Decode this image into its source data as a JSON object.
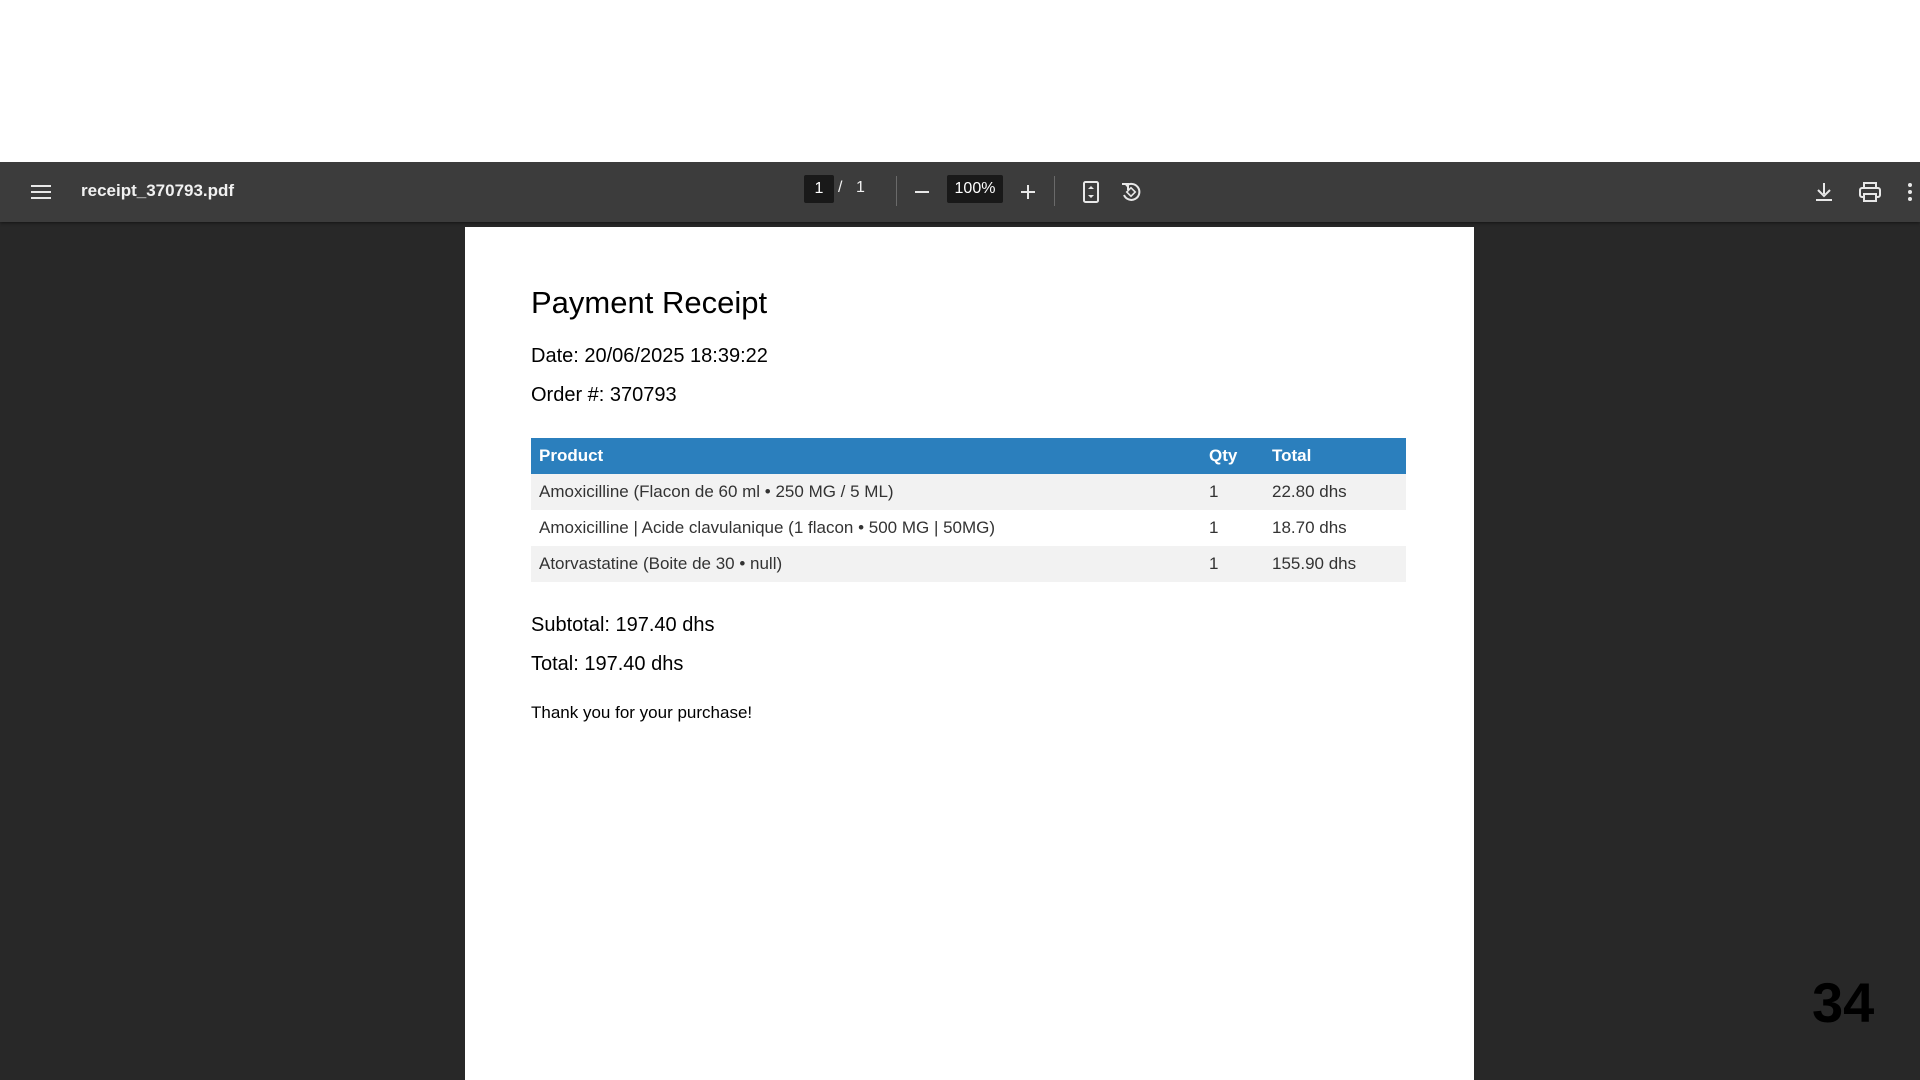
{
  "toolbar": {
    "menu_icon": "menu-icon",
    "file_name": "receipt_370793.pdf",
    "current_page": "1",
    "page_separator": "/",
    "total_pages": "1",
    "zoom_out_icon": "minus-icon",
    "zoom_level": "100%",
    "zoom_in_icon": "plus-icon",
    "fit_page_icon": "fit-page-icon",
    "rotate_icon": "rotate-counterclockwise-icon",
    "download_icon": "download-icon",
    "print_icon": "print-icon",
    "more_icon": "more-vertical-icon"
  },
  "receipt": {
    "title": "Payment Receipt",
    "date": "Date: 20/06/2025 18:39:22",
    "order": "Order #: 370793",
    "table": {
      "headers": [
        "Product",
        "Qty",
        "Total"
      ],
      "rows": [
        {
          "product": "Amoxicilline (Flacon de 60 ml • 250 MG / 5 ML)",
          "qty": "1",
          "total": "22.80 dhs"
        },
        {
          "product": "Amoxicilline | Acide clavulanique (1 flacon • 500 MG | 50MG)",
          "qty": "1",
          "total": "18.70 dhs"
        },
        {
          "product": "Atorvastatine (Boite de 30 • null)",
          "qty": "1",
          "total": "155.90 dhs"
        }
      ]
    },
    "subtotal": "Subtotal: 197.40 dhs",
    "total": "Total: 197.40 dhs",
    "thanks": "Thank you for your purchase!"
  },
  "slide_number": "34",
  "colors": {
    "toolbar_bg": "#3c3c3c",
    "viewer_bg": "#282828",
    "table_header_bg": "#2b7fbd",
    "row_stripe": "#f2f2f2"
  }
}
